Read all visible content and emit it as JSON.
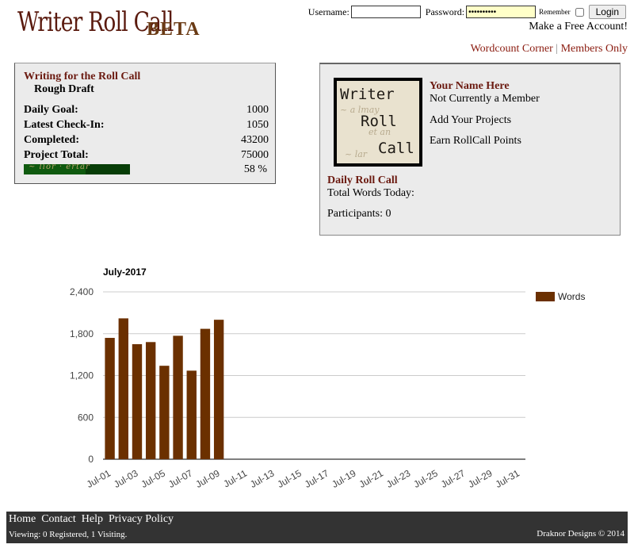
{
  "header": {
    "logo_main": "Writer Roll Call",
    "logo_beta": "BETA",
    "login": {
      "username_label": "Username:",
      "password_label": "Password:",
      "password_value": "••••••••••",
      "remember_label": "Remember",
      "login_button": "Login"
    },
    "free_account": "Make a Free Account!",
    "links": [
      "Wordcount Corner",
      "Members Only"
    ],
    "link_separator": "|"
  },
  "project_panel": {
    "title": "Writing for the Roll Call",
    "subtitle": "Rough Draft",
    "rows": [
      {
        "label": "Daily Goal:",
        "value": "1000"
      },
      {
        "label": "Latest Check-In:",
        "value": "1050"
      },
      {
        "label": "Completed:",
        "value": "43200"
      },
      {
        "label": "Project Total:",
        "value": "75000"
      }
    ],
    "progress_fraction": 0.58,
    "progress_percent": "58 %"
  },
  "member_panel": {
    "avatar_words": [
      "Writer",
      "Roll",
      "Call"
    ],
    "name": "Your Name Here",
    "status": "Not Currently a Member",
    "link_projects": "Add Your Projects",
    "link_points": "Earn RollCall Points",
    "daily_title": "Daily Roll Call",
    "total_words": "Total Words Today:",
    "participants": "Participants: 0"
  },
  "chart_data": {
    "type": "bar",
    "title": "July-2017",
    "xlabel": "",
    "ylabel": "",
    "ylim": [
      0,
      2400
    ],
    "yticks": [
      "0",
      "600",
      "1,200",
      "1,800",
      "2,400"
    ],
    "grid": true,
    "legend_position": "top-right",
    "categories": [
      "Jul-01",
      "Jul-02",
      "Jul-03",
      "Jul-04",
      "Jul-05",
      "Jul-06",
      "Jul-07",
      "Jul-08",
      "Jul-09",
      "Jul-10",
      "Jul-11",
      "Jul-12",
      "Jul-13",
      "Jul-14",
      "Jul-15",
      "Jul-16",
      "Jul-17",
      "Jul-18",
      "Jul-19",
      "Jul-20",
      "Jul-21",
      "Jul-22",
      "Jul-23",
      "Jul-24",
      "Jul-25",
      "Jul-26",
      "Jul-27",
      "Jul-28",
      "Jul-29",
      "Jul-30",
      "Jul-31"
    ],
    "x_tick_labels": [
      "Jul-01",
      "Jul-03",
      "Jul-05",
      "Jul-07",
      "Jul-09",
      "Jul-11",
      "Jul-13",
      "Jul-15",
      "Jul-17",
      "Jul-19",
      "Jul-21",
      "Jul-23",
      "Jul-25",
      "Jul-27",
      "Jul-29",
      "Jul-31"
    ],
    "series": [
      {
        "name": "Words",
        "color": "#6b3000",
        "values": [
          1740,
          2020,
          1650,
          1680,
          1340,
          1770,
          1270,
          1870,
          2000
        ]
      }
    ]
  },
  "footer": {
    "nav": [
      "Home",
      "Contact",
      "Help",
      "Privacy Policy"
    ],
    "viewing": "Viewing: 0 Registered, 1 Visiting.",
    "copyright": "Draknor Designs © 2014"
  }
}
